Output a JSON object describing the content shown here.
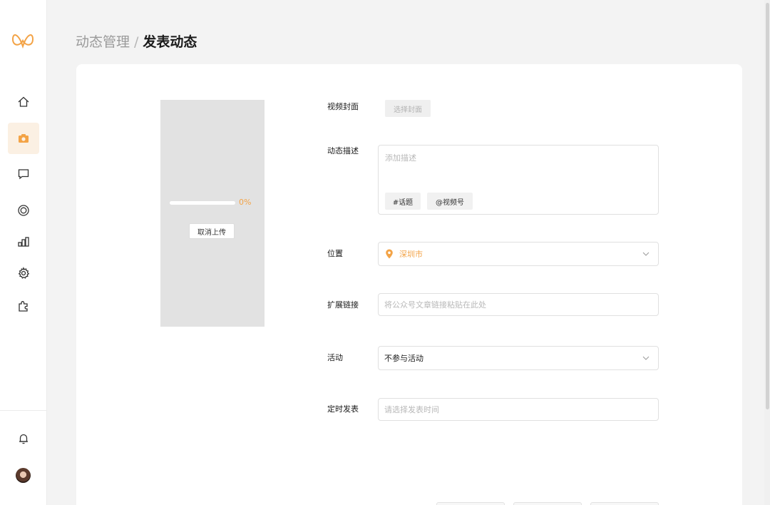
{
  "colors": {
    "accent": "#f3a346",
    "active_bg": "#fbf0e3"
  },
  "sidebar": {
    "logo": "logo-icon",
    "items": [
      {
        "icon": "home-icon"
      },
      {
        "icon": "camera-icon",
        "active": true
      },
      {
        "icon": "message-icon"
      },
      {
        "icon": "target-icon"
      },
      {
        "icon": "chart-icon"
      },
      {
        "icon": "gear-icon"
      },
      {
        "icon": "puzzle-icon"
      }
    ],
    "bottom": [
      {
        "icon": "bell-icon"
      },
      {
        "icon": "avatar"
      }
    ]
  },
  "breadcrumb": {
    "parent": "动态管理",
    "separator": "/",
    "current": "发表动态"
  },
  "preview": {
    "progress_percent": 0,
    "progress_text": "0%",
    "cancel_label": "取消上传"
  },
  "form": {
    "cover": {
      "label": "视频封面",
      "button": "选择封面"
    },
    "description": {
      "label": "动态描述",
      "placeholder": "添加描述",
      "topic_tag": "#话题",
      "channel_tag": "@视频号"
    },
    "location": {
      "label": "位置",
      "value": "深圳市"
    },
    "link": {
      "label": "扩展链接",
      "placeholder": "将公众号文章链接粘贴在此处"
    },
    "activity": {
      "label": "活动",
      "value": "不参与活动"
    },
    "schedule": {
      "label": "定时发表",
      "placeholder": "请选择发表时间"
    }
  }
}
